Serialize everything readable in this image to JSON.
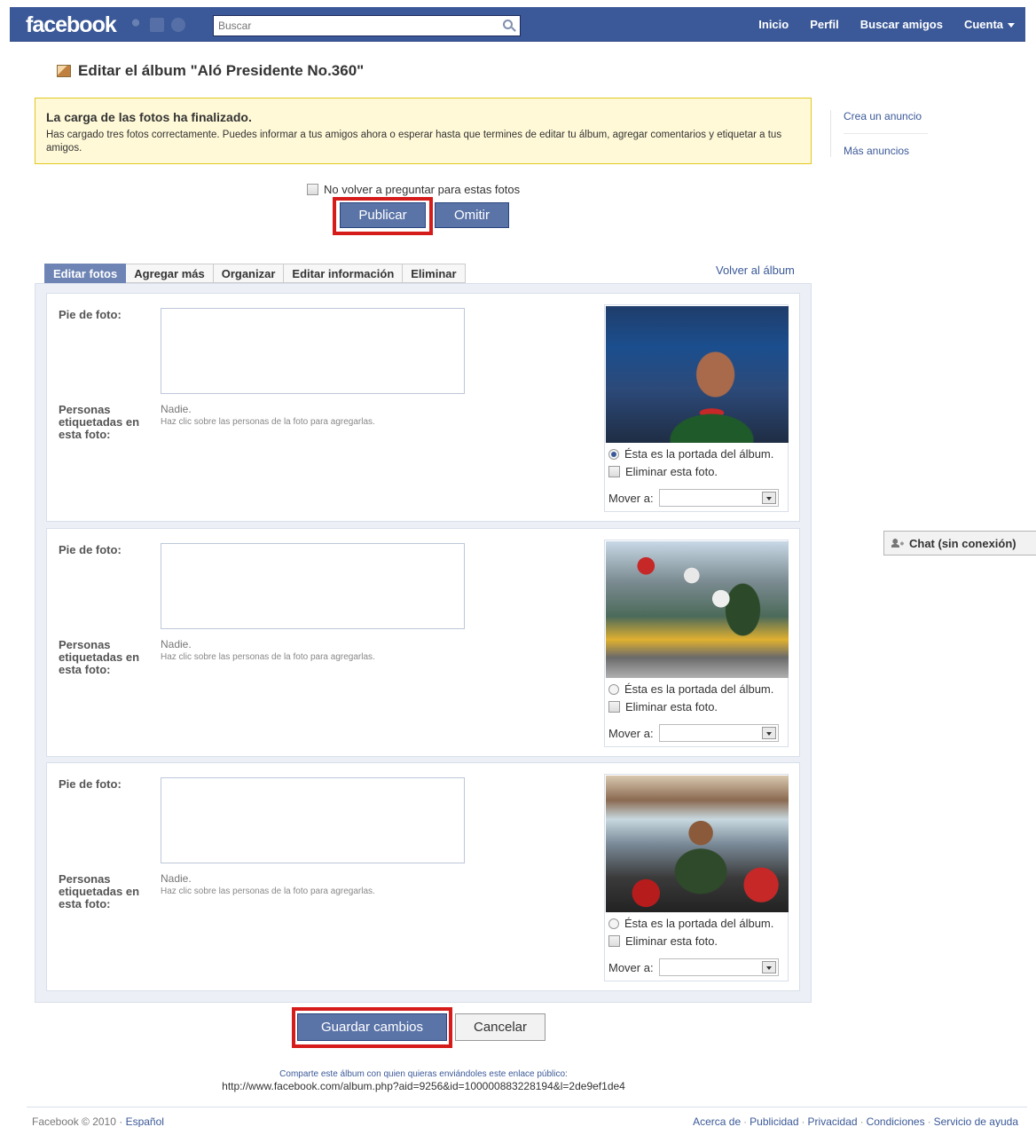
{
  "header": {
    "logo": "facebook",
    "search_placeholder": "Buscar",
    "nav": [
      "Inicio",
      "Perfil",
      "Buscar amigos",
      "Cuenta"
    ]
  },
  "page": {
    "title": "Editar el álbum \"Aló Presidente No.360\""
  },
  "notice": {
    "heading": "La carga de las fotos ha finalizado.",
    "body": "Has cargado tres fotos correctamente. Puedes informar a tus amigos ahora o esperar hasta que termines de editar tu álbum, agregar comentarios y etiquetar a tus amigos."
  },
  "ads": {
    "create": "Crea un anuncio",
    "more": "Más anuncios"
  },
  "publish_prompt": {
    "checkbox_label": "No volver a preguntar para estas fotos",
    "publish": "Publicar",
    "skip": "Omitir"
  },
  "tabs": [
    "Editar fotos",
    "Agregar más",
    "Organizar",
    "Editar información",
    "Eliminar"
  ],
  "back_link": "Volver al álbum",
  "photo_form": {
    "caption_label": "Pie de foto:",
    "tagged_label_1": "Personas",
    "tagged_label_2": "etiquetadas en",
    "tagged_label_3": "esta foto:",
    "tagged_value": "Nadie.",
    "tag_hint": "Haz clic sobre las personas de la foto para agregarlas.",
    "cover_label": "Ésta es la portada del álbum.",
    "delete_label": "Eliminar esta foto.",
    "move_label": "Mover a:"
  },
  "photos": [
    {
      "cover": true,
      "delete": false
    },
    {
      "cover": false,
      "delete": false
    },
    {
      "cover": false,
      "delete": false
    }
  ],
  "actions": {
    "save": "Guardar cambios",
    "cancel": "Cancelar"
  },
  "share": {
    "prompt": "Comparte este álbum con quien quieras enviándoles este enlace público:",
    "url": "http://www.facebook.com/album.php?aid=9256&id=100000883228194&l=2de9ef1de4"
  },
  "footer": {
    "copyright": "Facebook © 2010 ·",
    "language": "Español",
    "links": [
      "Acerca de",
      "Publicidad",
      "Privacidad",
      "Condiciones",
      "Servicio de ayuda"
    ]
  },
  "chat": {
    "label": "Chat (sin conexión)"
  },
  "colors": {
    "brand": "#3b5998",
    "highlight": "#d61b1b",
    "notice_bg": "#fff9d7"
  },
  "icons": [
    "friends-icon",
    "messages-icon",
    "notifications-icon",
    "search-icon",
    "album-icon",
    "chat-icon"
  ]
}
